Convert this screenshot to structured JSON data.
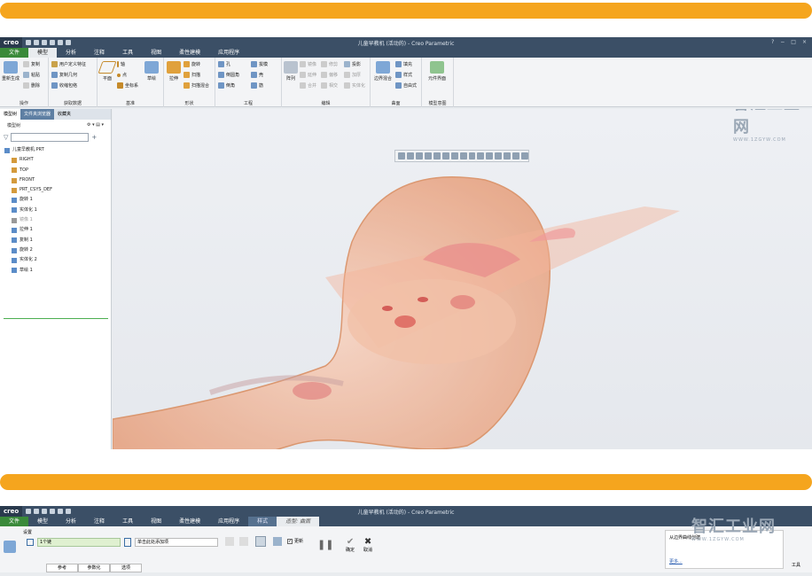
{
  "window": {
    "logo": "creo",
    "title": "儿童早教机 (活动的) - Creo Parametric",
    "controls": [
      "?",
      "−",
      "□",
      "×"
    ]
  },
  "tabs": [
    "文件",
    "模型",
    "分析",
    "注释",
    "工具",
    "视图",
    "柔性建模",
    "应用程序"
  ],
  "ribbon": {
    "groups": {
      "operations": "操作",
      "get_data": "获取数据",
      "datum": "基准",
      "shapes": "形状",
      "engineering": "工程",
      "edit": "编辑",
      "surface": "曲面",
      "model_intent": "模型意图"
    },
    "buttons": {
      "regenerate": "重新生成",
      "copy": "复制",
      "paste": "粘贴",
      "delete": "删除",
      "udf": "用户定义特征",
      "copy_geom": "复制几何",
      "shrinkwrap": "收缩包络",
      "plane": "平面",
      "axis": "轴",
      "point": "点",
      "csys": "坐标系",
      "sketch": "草绘",
      "extrude": "拉伸",
      "revolve": "旋转",
      "sweep": "扫描",
      "swept_blend": "扫描混合",
      "hole": "孔",
      "round": "倒圆角",
      "chamfer": "倒角",
      "draft": "拔模",
      "shell": "壳",
      "rib": "筋",
      "pattern": "阵列",
      "mirror": "镜像",
      "extend": "延伸",
      "trim": "修剪",
      "merge": "合并",
      "intersect": "相交",
      "offset": "偏移",
      "thicken": "加厚",
      "solidify": "实体化",
      "project": "投影",
      "fill": "填充",
      "style": "样式",
      "freestyle": "自由式",
      "boundary_blend": "边界混合",
      "component_interface": "元件界面"
    }
  },
  "model_tree": {
    "pane_tabs": [
      "模型树",
      "文件夹浏览器",
      "收藏夹"
    ],
    "header": "模型树",
    "items": [
      {
        "label": "儿童早教机.PRT",
        "dim": false
      },
      {
        "label": "RIGHT",
        "dim": false
      },
      {
        "label": "TOP",
        "dim": false
      },
      {
        "label": "FRONT",
        "dim": false
      },
      {
        "label": "PRT_CSYS_DEF",
        "dim": false
      },
      {
        "label": "旋转 1",
        "dim": false
      },
      {
        "label": "实体化 1",
        "dim": false
      },
      {
        "label": "镜像 1",
        "dim": true
      },
      {
        "label": "拉伸 1",
        "dim": false
      },
      {
        "label": "复制 1",
        "dim": false
      },
      {
        "label": "旋转 2",
        "dim": false
      },
      {
        "label": "实体化 2",
        "dim": false
      },
      {
        "label": "草绘 1",
        "dim": false
      }
    ]
  },
  "watermark": {
    "big": "智汇工业网",
    "small": "WWW.1ZGYW.COM"
  },
  "window2": {
    "logo": "creo",
    "title": "儿童早教机 (活动的) - Creo Parametric",
    "tabs": [
      "文件",
      "模型",
      "分析",
      "注释",
      "工具",
      "视图",
      "柔性建模",
      "应用程序",
      "样式",
      "造型: 曲面"
    ],
    "settings_label": "设置",
    "count_field": "1个链",
    "add_hint": "单击此处添加项",
    "checkbox_label": "更新",
    "ok_label": "确定",
    "cancel_label": "取消",
    "subtabs": [
      "参考",
      "参数化",
      "选项"
    ],
    "side_text": "从边界曲线创建",
    "more_link": "更多...",
    "tools_label": "工具"
  }
}
